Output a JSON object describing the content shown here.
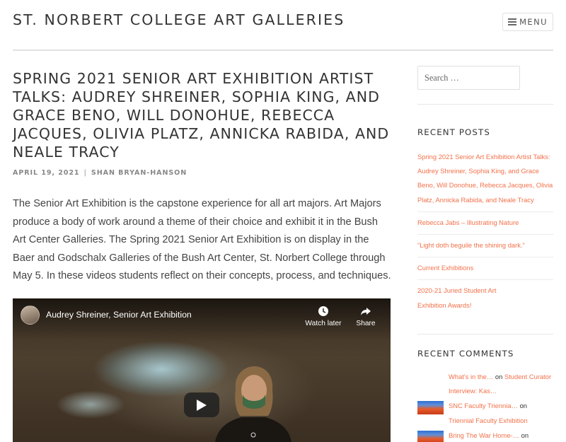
{
  "header": {
    "site_title": "ST. NORBERT COLLEGE ART GALLERIES",
    "menu_label": "MENU"
  },
  "post": {
    "title": "SPRING 2021 SENIOR ART EXHIBITION ARTIST TALKS: AUDREY SHREINER, SOPHIA KING, AND GRACE BENO, WILL DONOHUE, REBECCA JACQUES, OLIVIA PLATZ, ANNICKA RABIDA, AND NEALE TRACY",
    "date": "APRIL 19, 2021",
    "separator": "|",
    "author": "SHAN BRYAN-HANSON",
    "body": "The Senior Art Exhibition is the capstone experience for all art majors. Art Majors produce a body of work around a theme of their choice and exhibit it in the Bush Art Center Galleries. The Spring 2021 Senior Art Exhibition is on display in the Baer and Godschalx Galleries of the Bush Art Center, St. Norbert College through May 5.  In these videos students reflect on their concepts, process, and techniques."
  },
  "video": {
    "title": "Audrey Shreiner, Senior Art Exhibition",
    "watch_later": "Watch later",
    "share": "Share",
    "icons": [
      "clock-icon",
      "share-icon",
      "play-icon"
    ]
  },
  "sidebar": {
    "search_placeholder": "Search …",
    "recent_posts_title": "RECENT POSTS",
    "recent_posts": [
      "Spring 2021 Senior Art Exhibition Artist Talks: Audrey Shreiner, Sophia King, and Grace Beno, Will Donohue, Rebecca Jacques, Olivia Platz, Annicka Rabida, and Neale Tracy",
      "Rebecca Jabs – Illustrating Nature",
      "“Light doth beguile the shining dark.”",
      "Current Exhibitions",
      "2020-21 Juried Student Art Exhibition Awards!"
    ],
    "recent_comments_title": "RECENT COMMENTS",
    "recent_comments": [
      {
        "author": "What's in the…",
        "on": "on",
        "post": "Student Curator Interview: Kas…"
      },
      {
        "author": "SNC Faculty Triennia…",
        "on": "on",
        "post": "Triennial Faculty Exhibition"
      },
      {
        "author": "Bring The War Home-…",
        "on": "on",
        "post": ""
      }
    ]
  },
  "colors": {
    "accent": "#f2714a",
    "text": "#333333",
    "rule": "#e2e2e2"
  }
}
